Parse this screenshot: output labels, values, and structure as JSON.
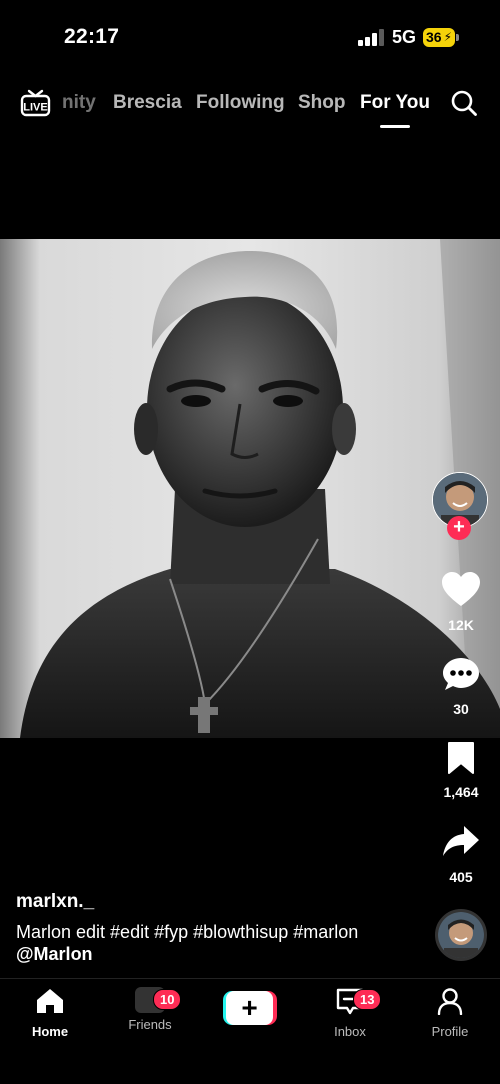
{
  "status_bar": {
    "time": "22:17",
    "network": "5G",
    "battery": "36"
  },
  "top_nav": {
    "live_label": "LIVE",
    "tabs": [
      {
        "label": "nity",
        "active": false
      },
      {
        "label": "Brescia",
        "active": false
      },
      {
        "label": "Following",
        "active": false
      },
      {
        "label": "Shop",
        "active": false
      },
      {
        "label": "For You",
        "active": true
      }
    ]
  },
  "actions": {
    "likes": "12K",
    "comments": "30",
    "saves": "1,464",
    "shares": "405"
  },
  "post": {
    "username": "marlxn._",
    "caption_text": "Marlon edit ",
    "hashtags": [
      "#edit",
      "#fyp",
      "#blowthisup",
      "#marlon"
    ],
    "mention": "@Marlon"
  },
  "bottom_nav": {
    "home": "Home",
    "friends": "Friends",
    "friends_badge": "10",
    "inbox": "Inbox",
    "inbox_badge": "13",
    "profile": "Profile"
  },
  "colors": {
    "accent_red": "#fe2c55",
    "accent_cyan": "#25f4ee",
    "battery_yellow": "#f5d30a"
  }
}
